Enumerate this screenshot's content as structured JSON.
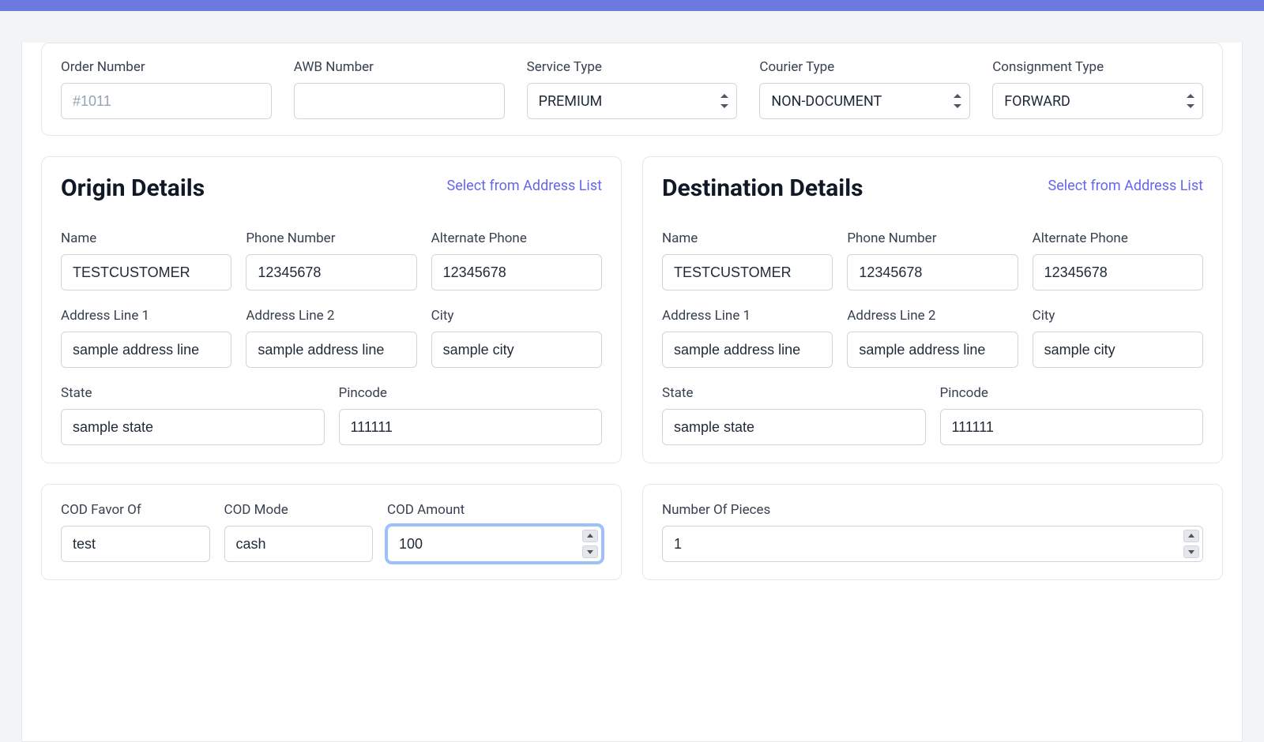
{
  "topCard": {
    "orderNumber": {
      "label": "Order Number",
      "placeholder": "#1011",
      "value": ""
    },
    "awbNumber": {
      "label": "AWB Number",
      "value": ""
    },
    "serviceType": {
      "label": "Service Type",
      "value": "PREMIUM"
    },
    "courierType": {
      "label": "Courier Type",
      "value": "NON-DOCUMENT"
    },
    "consignmentType": {
      "label": "Consignment Type",
      "value": "FORWARD"
    }
  },
  "origin": {
    "title": "Origin Details",
    "selectLink": "Select from Address List",
    "name": {
      "label": "Name",
      "value": "TESTCUSTOMER"
    },
    "phone": {
      "label": "Phone Number",
      "value": "12345678"
    },
    "altPhone": {
      "label": "Alternate Phone",
      "value": "12345678"
    },
    "addr1": {
      "label": "Address Line 1",
      "value": "sample address line"
    },
    "addr2": {
      "label": "Address Line 2",
      "value": "sample address line"
    },
    "city": {
      "label": "City",
      "value": "sample city"
    },
    "state": {
      "label": "State",
      "value": "sample state"
    },
    "pincode": {
      "label": "Pincode",
      "value": "111111"
    }
  },
  "destination": {
    "title": "Destination Details",
    "selectLink": "Select from Address List",
    "name": {
      "label": "Name",
      "value": "TESTCUSTOMER"
    },
    "phone": {
      "label": "Phone Number",
      "value": "12345678"
    },
    "altPhone": {
      "label": "Alternate Phone",
      "value": "12345678"
    },
    "addr1": {
      "label": "Address Line 1",
      "value": "sample address line"
    },
    "addr2": {
      "label": "Address Line 2",
      "value": "sample address line"
    },
    "city": {
      "label": "City",
      "value": "sample city"
    },
    "state": {
      "label": "State",
      "value": "sample state"
    },
    "pincode": {
      "label": "Pincode",
      "value": "111111"
    }
  },
  "cod": {
    "favorOf": {
      "label": "COD Favor Of",
      "value": "test"
    },
    "mode": {
      "label": "COD Mode",
      "value": "cash"
    },
    "amount": {
      "label": "COD Amount",
      "value": "100"
    }
  },
  "pieces": {
    "count": {
      "label": "Number Of Pieces",
      "value": "1"
    }
  }
}
